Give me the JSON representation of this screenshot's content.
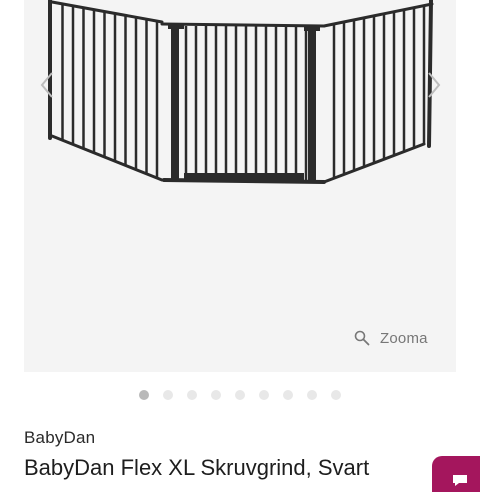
{
  "gallery": {
    "image": {
      "alt": "BabyDan Flex XL Skruvgrind, Svart",
      "icon": "baby-gate-image"
    },
    "prev_icon": "chevron-left-icon",
    "next_icon": "chevron-right-icon",
    "zoom_label": "Zooma",
    "zoom_icon": "magnifier-icon",
    "pagination": {
      "count": 9,
      "active": 1
    }
  },
  "product": {
    "brand": "BabyDan",
    "title": "BabyDan Flex XL Skruvgrind, Svart"
  },
  "colors": {
    "accent": "#a4165d",
    "gate": "#2b2b2b",
    "gallery_bg": "#f4f4f4"
  }
}
